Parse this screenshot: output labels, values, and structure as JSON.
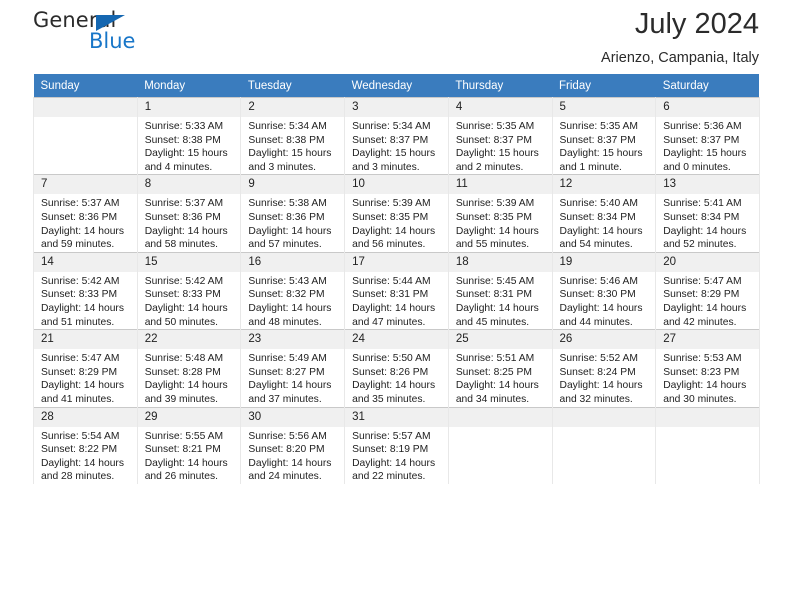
{
  "brand": {
    "name_top": "General",
    "name_bottom": "Blue",
    "accent_color": "#1876c8",
    "triangle_color": "#1567b1"
  },
  "header": {
    "title": "July 2024",
    "subtitle": "Arienzo, Campania, Italy"
  },
  "calendar": {
    "header_bg": "#3a7cbe",
    "daynum_bg": "#f0f0f0",
    "weekdays": [
      "Sunday",
      "Monday",
      "Tuesday",
      "Wednesday",
      "Thursday",
      "Friday",
      "Saturday"
    ],
    "labels": {
      "sunrise": "Sunrise:",
      "sunset": "Sunset:",
      "daylight": "Daylight:"
    },
    "weeks": [
      [
        {
          "day": "",
          "empty": true
        },
        {
          "day": "1",
          "sunrise": "Sunrise: 5:33 AM",
          "sunset": "Sunset: 8:38 PM",
          "daylight": "Daylight: 15 hours and 4 minutes."
        },
        {
          "day": "2",
          "sunrise": "Sunrise: 5:34 AM",
          "sunset": "Sunset: 8:38 PM",
          "daylight": "Daylight: 15 hours and 3 minutes."
        },
        {
          "day": "3",
          "sunrise": "Sunrise: 5:34 AM",
          "sunset": "Sunset: 8:37 PM",
          "daylight": "Daylight: 15 hours and 3 minutes."
        },
        {
          "day": "4",
          "sunrise": "Sunrise: 5:35 AM",
          "sunset": "Sunset: 8:37 PM",
          "daylight": "Daylight: 15 hours and 2 minutes."
        },
        {
          "day": "5",
          "sunrise": "Sunrise: 5:35 AM",
          "sunset": "Sunset: 8:37 PM",
          "daylight": "Daylight: 15 hours and 1 minute."
        },
        {
          "day": "6",
          "sunrise": "Sunrise: 5:36 AM",
          "sunset": "Sunset: 8:37 PM",
          "daylight": "Daylight: 15 hours and 0 minutes."
        }
      ],
      [
        {
          "day": "7",
          "sunrise": "Sunrise: 5:37 AM",
          "sunset": "Sunset: 8:36 PM",
          "daylight": "Daylight: 14 hours and 59 minutes."
        },
        {
          "day": "8",
          "sunrise": "Sunrise: 5:37 AM",
          "sunset": "Sunset: 8:36 PM",
          "daylight": "Daylight: 14 hours and 58 minutes."
        },
        {
          "day": "9",
          "sunrise": "Sunrise: 5:38 AM",
          "sunset": "Sunset: 8:36 PM",
          "daylight": "Daylight: 14 hours and 57 minutes."
        },
        {
          "day": "10",
          "sunrise": "Sunrise: 5:39 AM",
          "sunset": "Sunset: 8:35 PM",
          "daylight": "Daylight: 14 hours and 56 minutes."
        },
        {
          "day": "11",
          "sunrise": "Sunrise: 5:39 AM",
          "sunset": "Sunset: 8:35 PM",
          "daylight": "Daylight: 14 hours and 55 minutes."
        },
        {
          "day": "12",
          "sunrise": "Sunrise: 5:40 AM",
          "sunset": "Sunset: 8:34 PM",
          "daylight": "Daylight: 14 hours and 54 minutes."
        },
        {
          "day": "13",
          "sunrise": "Sunrise: 5:41 AM",
          "sunset": "Sunset: 8:34 PM",
          "daylight": "Daylight: 14 hours and 52 minutes."
        }
      ],
      [
        {
          "day": "14",
          "sunrise": "Sunrise: 5:42 AM",
          "sunset": "Sunset: 8:33 PM",
          "daylight": "Daylight: 14 hours and 51 minutes."
        },
        {
          "day": "15",
          "sunrise": "Sunrise: 5:42 AM",
          "sunset": "Sunset: 8:33 PM",
          "daylight": "Daylight: 14 hours and 50 minutes."
        },
        {
          "day": "16",
          "sunrise": "Sunrise: 5:43 AM",
          "sunset": "Sunset: 8:32 PM",
          "daylight": "Daylight: 14 hours and 48 minutes."
        },
        {
          "day": "17",
          "sunrise": "Sunrise: 5:44 AM",
          "sunset": "Sunset: 8:31 PM",
          "daylight": "Daylight: 14 hours and 47 minutes."
        },
        {
          "day": "18",
          "sunrise": "Sunrise: 5:45 AM",
          "sunset": "Sunset: 8:31 PM",
          "daylight": "Daylight: 14 hours and 45 minutes."
        },
        {
          "day": "19",
          "sunrise": "Sunrise: 5:46 AM",
          "sunset": "Sunset: 8:30 PM",
          "daylight": "Daylight: 14 hours and 44 minutes."
        },
        {
          "day": "20",
          "sunrise": "Sunrise: 5:47 AM",
          "sunset": "Sunset: 8:29 PM",
          "daylight": "Daylight: 14 hours and 42 minutes."
        }
      ],
      [
        {
          "day": "21",
          "sunrise": "Sunrise: 5:47 AM",
          "sunset": "Sunset: 8:29 PM",
          "daylight": "Daylight: 14 hours and 41 minutes."
        },
        {
          "day": "22",
          "sunrise": "Sunrise: 5:48 AM",
          "sunset": "Sunset: 8:28 PM",
          "daylight": "Daylight: 14 hours and 39 minutes."
        },
        {
          "day": "23",
          "sunrise": "Sunrise: 5:49 AM",
          "sunset": "Sunset: 8:27 PM",
          "daylight": "Daylight: 14 hours and 37 minutes."
        },
        {
          "day": "24",
          "sunrise": "Sunrise: 5:50 AM",
          "sunset": "Sunset: 8:26 PM",
          "daylight": "Daylight: 14 hours and 35 minutes."
        },
        {
          "day": "25",
          "sunrise": "Sunrise: 5:51 AM",
          "sunset": "Sunset: 8:25 PM",
          "daylight": "Daylight: 14 hours and 34 minutes."
        },
        {
          "day": "26",
          "sunrise": "Sunrise: 5:52 AM",
          "sunset": "Sunset: 8:24 PM",
          "daylight": "Daylight: 14 hours and 32 minutes."
        },
        {
          "day": "27",
          "sunrise": "Sunrise: 5:53 AM",
          "sunset": "Sunset: 8:23 PM",
          "daylight": "Daylight: 14 hours and 30 minutes."
        }
      ],
      [
        {
          "day": "28",
          "sunrise": "Sunrise: 5:54 AM",
          "sunset": "Sunset: 8:22 PM",
          "daylight": "Daylight: 14 hours and 28 minutes."
        },
        {
          "day": "29",
          "sunrise": "Sunrise: 5:55 AM",
          "sunset": "Sunset: 8:21 PM",
          "daylight": "Daylight: 14 hours and 26 minutes."
        },
        {
          "day": "30",
          "sunrise": "Sunrise: 5:56 AM",
          "sunset": "Sunset: 8:20 PM",
          "daylight": "Daylight: 14 hours and 24 minutes."
        },
        {
          "day": "31",
          "sunrise": "Sunrise: 5:57 AM",
          "sunset": "Sunset: 8:19 PM",
          "daylight": "Daylight: 14 hours and 22 minutes."
        },
        {
          "day": "",
          "empty": true
        },
        {
          "day": "",
          "empty": true
        },
        {
          "day": "",
          "empty": true
        }
      ]
    ]
  }
}
